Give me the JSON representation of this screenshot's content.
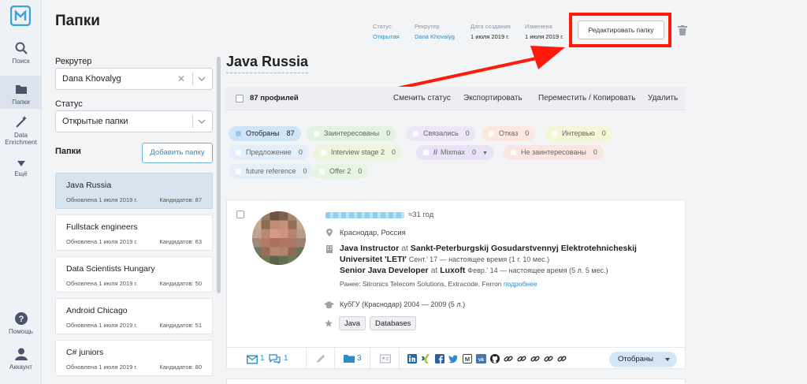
{
  "nav": {
    "items": [
      {
        "label": "Поиск",
        "icon": "search-icon"
      },
      {
        "label": "Папки",
        "icon": "folder-icon"
      },
      {
        "label_line1": "Data",
        "label_line2": "Enrichment",
        "icon": "magic-wand-icon"
      },
      {
        "label": "Ещё",
        "icon": "chevron-down-icon"
      },
      {
        "label": "Помощь",
        "icon": "help-icon"
      },
      {
        "label": "Аккаунт",
        "icon": "user-icon"
      }
    ]
  },
  "panel": {
    "title": "Папки",
    "recruiter_label": "Рекрутер",
    "recruiter_value": "Dana Khovalyg",
    "status_label": "Статус",
    "status_value": "Открытые папки",
    "folders_label": "Папки",
    "add_folder": "Добавить папку",
    "folders": [
      {
        "name": "Java Russia",
        "updated": "Обновлена 1 июля 2019 г.",
        "count": "Кандидатов: 87"
      },
      {
        "name": "Fullstack engineers",
        "updated": "Обновлена 1 июля 2019 г.",
        "count": "Кандидатов: 63"
      },
      {
        "name": "Data Scientists Hungary",
        "updated": "Обновлена 1 июля 2019 г.",
        "count": "Кандидатов: 50"
      },
      {
        "name": "Android Chicago",
        "updated": "Обновлена 1 июля 2019 г.",
        "count": "Кандидатов: 51"
      },
      {
        "name": "C# juniors",
        "updated": "Обновлена 1 июля 2019 г.",
        "count": "Кандидатов: 80"
      }
    ]
  },
  "header": {
    "meta": [
      {
        "key": "Статус",
        "value": "Открытая"
      },
      {
        "key": "Рекрутер",
        "value": "Dana Khovalyg"
      },
      {
        "key": "Дата создания",
        "value": "1 июля 2019 г."
      },
      {
        "key": "Изменена",
        "value": "1 июля 2019 г."
      }
    ],
    "edit_button": "Редактировать папку",
    "folder_title": "Java Russia"
  },
  "toolbar": {
    "count": "87 профилей",
    "actions": [
      "Сменить статус",
      "Экспортировать",
      "Переместить / Копировать",
      "Удалить"
    ]
  },
  "chips": [
    {
      "label": "Отобраны",
      "n": "87",
      "bg": "#cfe4f6",
      "fg": "#222"
    },
    {
      "label": "Заинтересованы",
      "n": "0",
      "bg": "#e3f3e3",
      "fg": "#666"
    },
    {
      "label": "Связались",
      "n": "0",
      "bg": "#ece6f6",
      "fg": "#666"
    },
    {
      "label": "Отказ",
      "n": "0",
      "bg": "#fbe8e0",
      "fg": "#666"
    },
    {
      "label": "Интервью",
      "n": "0",
      "bg": "#f5f6d8",
      "fg": "#666"
    },
    {
      "label": "Предложение",
      "n": "0",
      "bg": "#e4eff9",
      "fg": "#666"
    },
    {
      "label": "Interview stage 2",
      "n": "0",
      "bg": "#edf5dd",
      "fg": "#666"
    },
    {
      "label": "Mixmax",
      "n": "0",
      "bg": "#e9e3f5",
      "fg": "#666"
    },
    {
      "label": "Не заинтересованы",
      "n": "0",
      "bg": "#fbe5e3",
      "fg": "#666"
    },
    {
      "label": "future reference",
      "n": "0",
      "bg": "#e6eff8",
      "fg": "#666"
    },
    {
      "label": "Offer 2",
      "n": "0",
      "bg": "#e8f4e2",
      "fg": "#666"
    }
  ],
  "candidate": {
    "age": "≈31 год",
    "location": "Краснодар, Россия",
    "job1_title": "Java Instructor",
    "job1_at": "at",
    "job1_company": "Sankt-Peterburgskij Gosudarstvennyj Elektrotehnicheskij",
    "job1_company2": "Universitet 'LETI'",
    "job1_period": "Сент.' 17 — настоящее время (1 г. 10 мес.)",
    "job2_title": "Senior Java Developer",
    "job2_at": "at",
    "job2_company": "Luxoft",
    "job2_period": "Февр.' 14 — настоящее время (5 л. 5 мес.)",
    "previous_label": "Ранее:",
    "previous": "Sitronics Telecom Solutions, Extracode, Ferron",
    "more_link": "подробнее",
    "education": "КубГУ (Краснодар) 2004 — 2009 (5 л.)",
    "tags": [
      "Java",
      "Databases"
    ],
    "mail_count": "1",
    "chat_count": "1",
    "folder_count": "3",
    "status": "Отобраны"
  },
  "colors": {
    "accent": "#2d8bc9",
    "highlight": "#ff1a0a"
  }
}
